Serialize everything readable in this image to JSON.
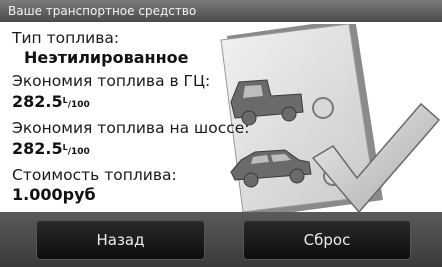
{
  "title_bar": {
    "title": "Ваше транспортное средство"
  },
  "fields": {
    "fuel_type": {
      "label": "Тип топлива:",
      "value": "Неэтилированное"
    },
    "city_economy": {
      "label": "Экономия топлива в ГЦ:",
      "value": "282.5",
      "unit_num": "L",
      "unit_den": "100"
    },
    "highway_economy": {
      "label": "Экономия топлива на шоссе:",
      "value": "282.5",
      "unit_num": "L",
      "unit_den": "100"
    },
    "fuel_cost": {
      "label": "Стоимость топлива:",
      "value": "1.000руб"
    }
  },
  "buttons": {
    "back_label": "Назад",
    "reset_label": "Сброс"
  },
  "icons": {
    "illustration": "vehicle-checklist-icon"
  }
}
